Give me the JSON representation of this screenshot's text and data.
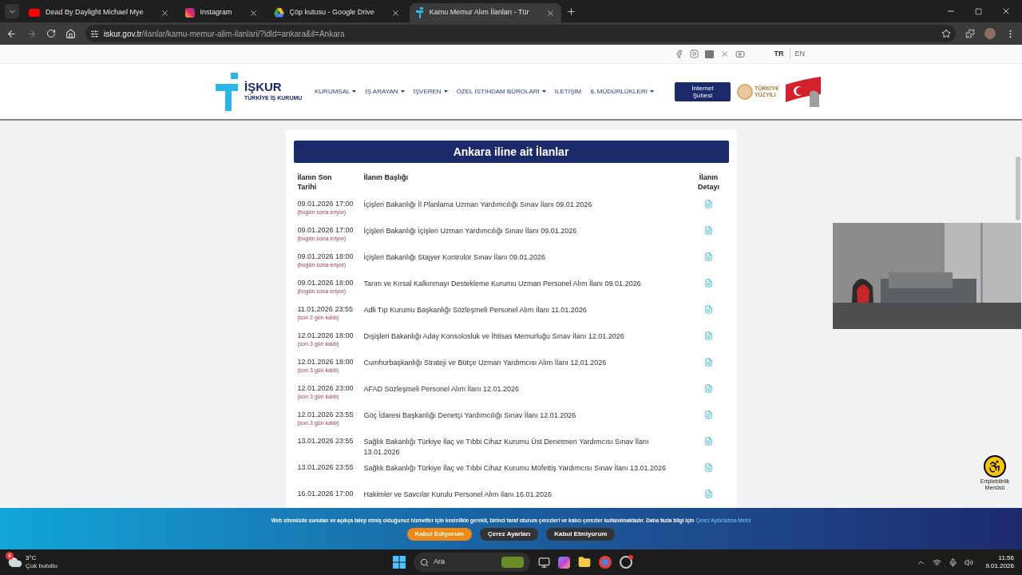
{
  "browser": {
    "tabs": [
      {
        "title": "Dead By Daylight Michael Mye",
        "kind": "video",
        "selected": false
      },
      {
        "title": "Instagram",
        "kind": "camera",
        "selected": false
      },
      {
        "title": "Çöp kutusu - Google Drive",
        "kind": "drive",
        "selected": false
      },
      {
        "title": "Kamu Memur Alım İlanları - Tür",
        "kind": "site",
        "selected": true
      }
    ],
    "url_host": "iskur.gov.tr",
    "url_path": "/ilanlar/kamu-memur-alim-ilanlari/?idld=ankara&il=Ankara"
  },
  "topbar": {
    "languages": [
      {
        "label": "TR",
        "selected": true
      },
      {
        "label": "EN",
        "selected": false
      }
    ]
  },
  "header": {
    "logo_title": "İŞKUR",
    "logo_subtitle": "TÜRKİYE İŞ KURUMU",
    "nav": [
      {
        "label": "KURUMSAL",
        "dropdown": true
      },
      {
        "label": "İŞ ARAYAN",
        "dropdown": true
      },
      {
        "label": "İŞVEREN",
        "dropdown": true
      },
      {
        "label": "ÖZEL İSTİHDAM BÜROLARI",
        "dropdown": true
      },
      {
        "label": "İLETİŞİM",
        "dropdown": false
      },
      {
        "label": "İL MÜDÜRLÜKLERİ",
        "dropdown": true
      }
    ],
    "button": "İnternet Şubesi",
    "badge_line1": "TÜRKİYE",
    "badge_line2": "YÜZYILI"
  },
  "listing": {
    "title": "Ankara iline ait İlanlar",
    "columns": [
      "İlanın Son Tarihi",
      "İlanın Başlığı",
      "İlanın Detayı"
    ],
    "rows": [
      {
        "deadline": "09.01.2026 17:00",
        "note": "(bugün sona eriyor)",
        "title": "İçişleri Bakanlığı İl Planlama Uzman Yardımcılığı Sınav İlanı 09.01.2026"
      },
      {
        "deadline": "09.01.2026 17:00",
        "note": "(bugün sona eriyor)",
        "title": "İçişleri Bakanlığı İçişleri Uzman Yardımcılığı Sınav İlanı 09.01.2026"
      },
      {
        "deadline": "09.01.2026 18:00",
        "note": "(bugün sona eriyor)",
        "title": "İçişleri Bakanlığı Stajyer Kontrolör Sınav İlanı 09.01.2026"
      },
      {
        "deadline": "09.01.2026 18:00",
        "note": "(bugün sona eriyor)",
        "title": "Tarım ve Kırsal Kalkınmayı Destekleme Kurumu Uzman Personel Alım İlanı 09.01.2026"
      },
      {
        "deadline": "11.01.2026 23:55",
        "note": "(son 2 gün kaldı)",
        "title": "Adli Tıp Kurumu Başkanlığı Sözleşmeli Personel Alım İlanı 11.01.2026"
      },
      {
        "deadline": "12.01.2026 18:00",
        "note": "(son 3 gün kaldı)",
        "title": "Dışişleri Bakanlığı Aday Konsolosluk ve İhtisas Memurluğu Sınav İlanı 12.01.2026"
      },
      {
        "deadline": "12.01.2026 18:00",
        "note": "(son 3 gün kaldı)",
        "title": "Cumhurbaşkanlığı Strateji ve Bütçe Uzman Yardımcısı Alım İlanı 12.01.2026"
      },
      {
        "deadline": "12.01.2026 23:00",
        "note": "(son 3 gün kaldı)",
        "title": "AFAD Sözleşmeli Personel Alım İlanı 12.01.2026"
      },
      {
        "deadline": "12.01.2026 23:55",
        "note": "(son 3 gün kaldı)",
        "title": "Göç İdaresi Başkanlığı Denetçi Yardımcılığı Sınav İlanı 12.01.2026"
      },
      {
        "deadline": "13.01.2026 23:55",
        "title": "Sağlık Bakanlığı Türkiye İlaç ve Tıbbi Cihaz Kurumu Üst Denetmen Yardımcısı Sınav İlanı 13.01.2026"
      },
      {
        "deadline": "13.01.2026 23:55",
        "title": "Sağlık Bakanlığı Türkiye İlaç ve Tıbbi Cihaz Kurumu Müfettiş Yardımcısı Sınav İlanı 13.01.2026"
      },
      {
        "deadline": "16.01.2026 17:00",
        "title": "Hakimler ve Savcılar Kurulu Personel Alım ilanı 16.01.2026"
      }
    ]
  },
  "accessibility": {
    "label": "Erişilebilirlik Menüsü"
  },
  "cookie_banner": {
    "text": "Web sitemizde sunulan ve açıkça talep etmiş olduğunuz hizmetler için kesinlikle gerekli, birinci taraf oturum çerezleri ve kalıcı çerezler kullanılmaktadır. Daha fazla bilgi için",
    "link": "Çerez Aydınlatma Metni",
    "buttons": [
      {
        "label": "Kabul Ediyorum",
        "kind": "primary"
      },
      {
        "label": "Çerez Ayarları",
        "kind": "secondary"
      },
      {
        "label": "Kabul Etmiyorum",
        "kind": "secondary"
      }
    ]
  },
  "taskbar": {
    "weather_badge": "4",
    "temperature": "3°C",
    "condition": "Çok bulutlu",
    "search": "Ara",
    "time": "11:56",
    "date": "9.01.2026"
  }
}
